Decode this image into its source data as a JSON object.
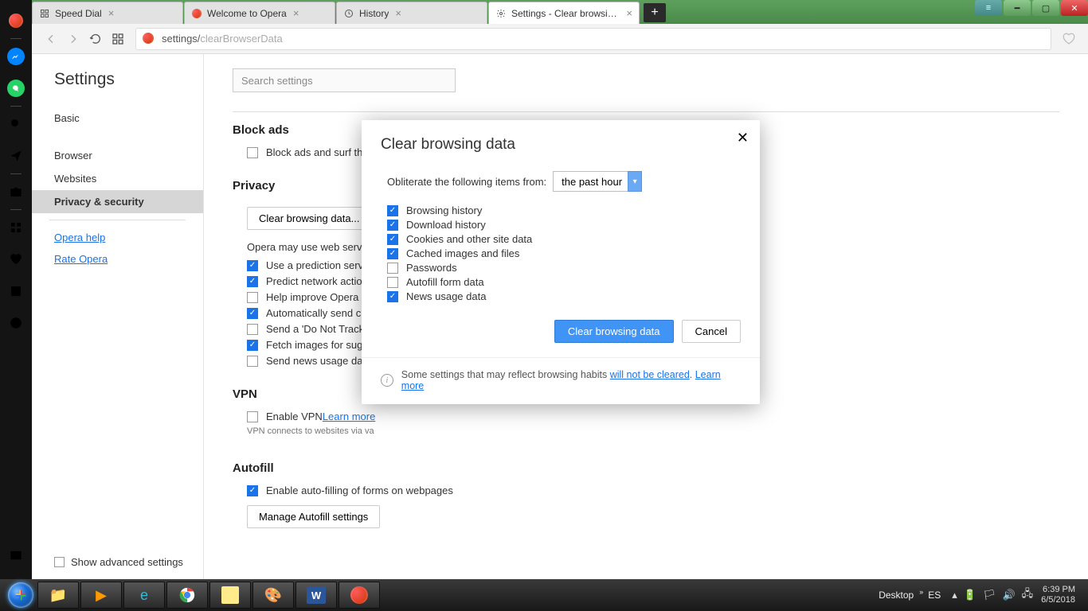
{
  "tabs": [
    {
      "title": "Speed Dial"
    },
    {
      "title": "Welcome to Opera"
    },
    {
      "title": "History"
    },
    {
      "title": "Settings - Clear browsing d"
    }
  ],
  "address": {
    "prefix": "settings/",
    "suffix": "clearBrowserData"
  },
  "sidebar": {
    "title": "Settings",
    "nav": [
      "Basic",
      "Browser",
      "Websites",
      "Privacy & security"
    ],
    "links": [
      "Opera help",
      "Rate Opera"
    ],
    "advanced": "Show advanced settings"
  },
  "settings": {
    "search_placeholder": "Search settings",
    "blockads_h": "Block ads",
    "blockads_label": "Block ads and surf the web up to three times faster ",
    "learn_more": "Learn more",
    "privacy_h": "Privacy",
    "clear_btn": "Clear browsing data...",
    "privacy_note": "Opera may use web service",
    "p1": "Use a prediction service",
    "p2": "Predict network actions",
    "p3": "Help improve Opera by",
    "p4": "Automatically send cras",
    "p5": "Send a 'Do Not Track' r",
    "p6": "Fetch images for sugge",
    "p7": "Send news usage data f",
    "vpn_h": "VPN",
    "vpn_label": "Enable VPN ",
    "vpn_note": "VPN connects to websites via va",
    "autofill_h": "Autofill",
    "autofill_label": "Enable auto-filling of forms on webpages",
    "autofill_btn": "Manage Autofill settings"
  },
  "modal": {
    "title": "Clear browsing data",
    "obliterate": "Obliterate the following items from:",
    "range": "the past hour",
    "opts": [
      {
        "label": "Browsing history",
        "checked": true
      },
      {
        "label": "Download history",
        "checked": true
      },
      {
        "label": "Cookies and other site data",
        "checked": true
      },
      {
        "label": "Cached images and files",
        "checked": true
      },
      {
        "label": "Passwords",
        "checked": false
      },
      {
        "label": "Autofill form data",
        "checked": false
      },
      {
        "label": "News usage data",
        "checked": true
      }
    ],
    "clear": "Clear browsing data",
    "cancel": "Cancel",
    "footer_pre": "Some settings that may reflect browsing habits ",
    "footer_link1": "will not be cleared",
    "footer_sep": ". ",
    "footer_link2": "Learn more"
  },
  "taskbar": {
    "desktop": "Desktop",
    "lang": "ES",
    "time": "6:39 PM",
    "date": "6/5/2018"
  }
}
